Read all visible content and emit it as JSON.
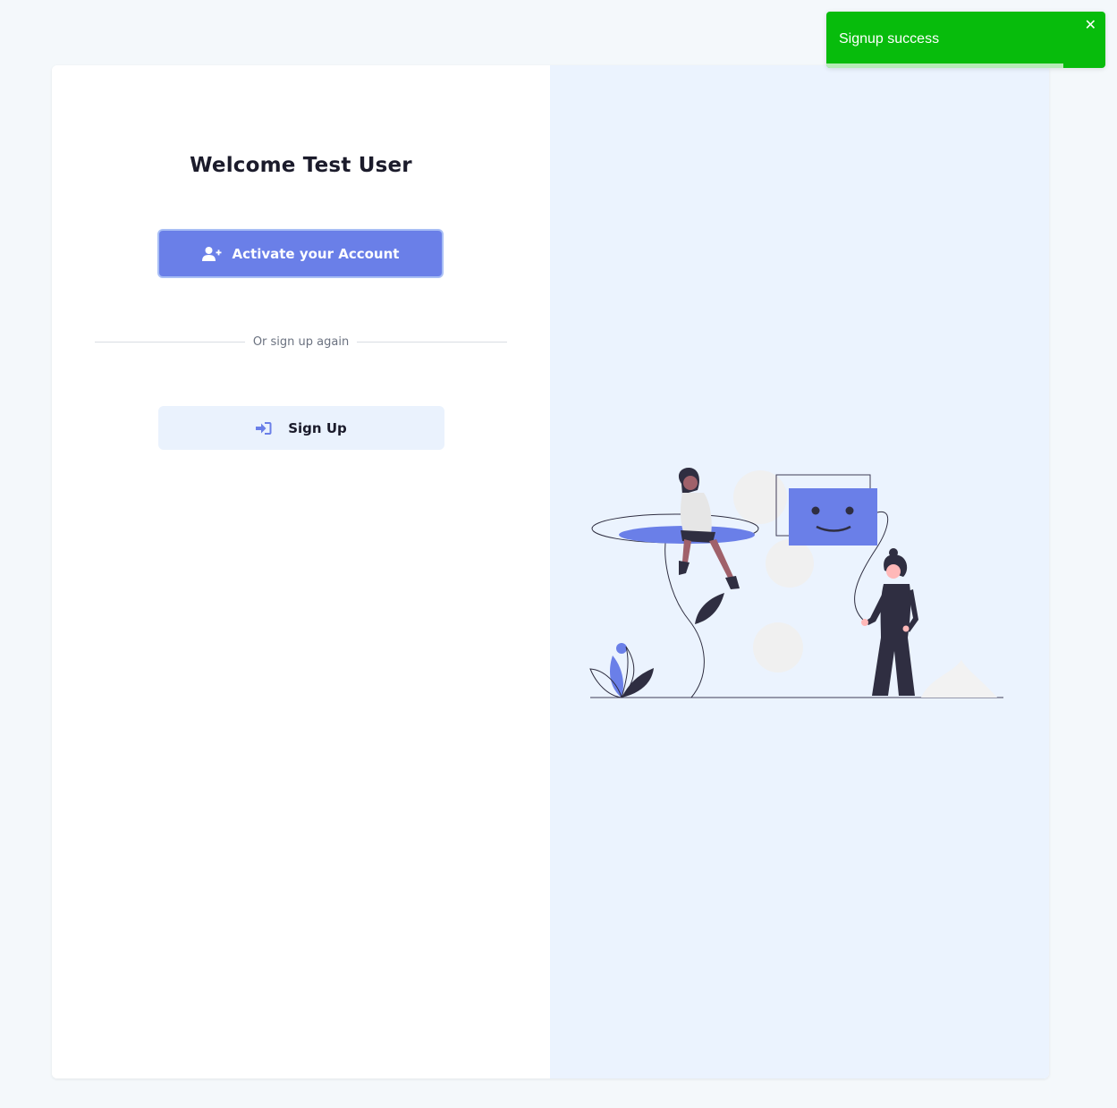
{
  "welcome": {
    "title": "Welcome Test User"
  },
  "activate_button": {
    "label": "Activate your Account",
    "icon": "user-plus-icon"
  },
  "divider": {
    "text": "Or sign up again"
  },
  "signup_button": {
    "label": "Sign Up",
    "icon": "sign-in-icon"
  },
  "toast": {
    "message": "Signup success",
    "close_label": "✕",
    "progress_fraction": 0.85,
    "color": "#07bc0c"
  },
  "colors": {
    "accent": "#6a7fe8",
    "illustration_dark": "#2f2e41",
    "panel_bg": "#ebf3fe"
  }
}
